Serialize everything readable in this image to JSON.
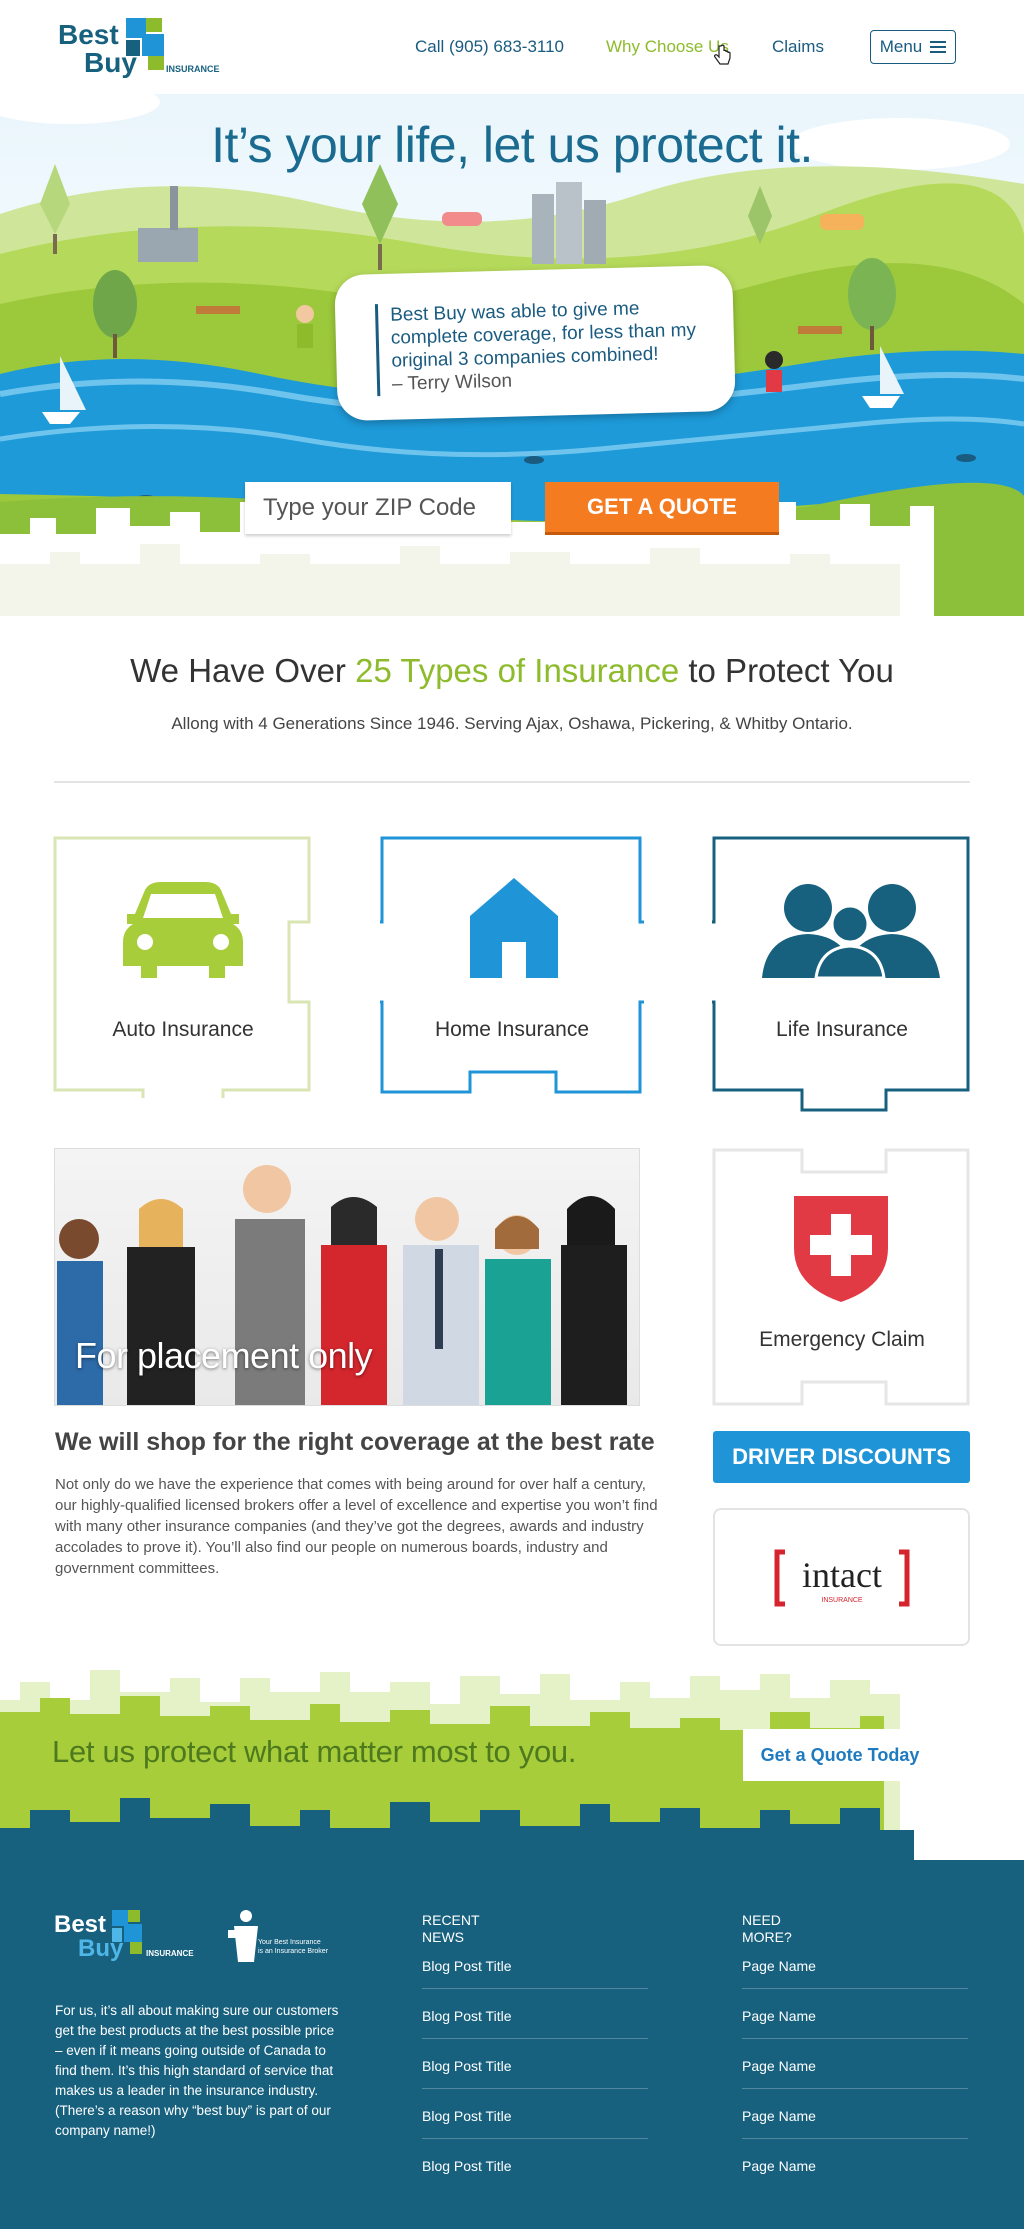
{
  "header": {
    "logo_top": "Best",
    "logo_bottom": "Buy",
    "logo_tag": "INSURANCE",
    "nav": [
      {
        "label": "Call (905) 683-3110"
      },
      {
        "label": "Why Choose Us"
      },
      {
        "label": "Claims"
      }
    ],
    "menu_label": "Menu"
  },
  "hero": {
    "title": "It’s your life, let us protect it.",
    "testimonial": "Best Buy was able to give me complete coverage, for less than my original 3 companies combined!",
    "testimonial_author": "– Terry Wilson",
    "zip_placeholder": "Type your ZIP Code",
    "quote_button": "GET A QUOTE"
  },
  "types": {
    "title_pre": "We Have Over ",
    "title_highlight": "25 Types of Insurance",
    "title_post": " to Protect You",
    "subtitle": "Allong with 4 Generations Since 1946. Serving Ajax, Oshawa, Pickering, & Whitby Ontario.",
    "tiles": [
      {
        "label": "Auto Insurance",
        "icon": "car-icon",
        "color": "#a8cd3a"
      },
      {
        "label": "Home Insurance",
        "icon": "house-icon",
        "color": "#1f95d8"
      },
      {
        "label": "Life Insurance",
        "icon": "family-icon",
        "color": "#17617f"
      },
      {
        "label": "Emergency Claim",
        "icon": "swiss-cross-shield-icon",
        "color": "#e23a45"
      }
    ]
  },
  "team": {
    "placement_text": "For placement only"
  },
  "shop": {
    "title": "We will shop for the right coverage at the best rate",
    "body": "Not only do we have the experience that comes with being around for over half a century, our highly-qualified licensed brokers offer a level of excellence and expertise you won’t find with many other insurance companies (and they’ve got the degrees, awards and industry accolades to prove it). You’ll also find our people on numerous boards, industry and government committees."
  },
  "sidebar": {
    "driver_discounts": "DRIVER DISCOUNTS",
    "partner_logo": "intact",
    "partner_logo_sub": "INSURANCE"
  },
  "cta": {
    "text": "Let us protect what matter most to you.",
    "button": "Get a Quote Today"
  },
  "footer": {
    "logo_top": "Best",
    "logo_bottom": "Buy",
    "logo_tag": "INSURANCE",
    "broker_line1": "Your Best Insurance",
    "broker_line2": "is an Insurance Broker",
    "about": "For us, it’s all about making sure our customers get the best products at the best possible price – even if it means going outside of Canada to find them. It’s this high standard of service that makes us a leader in the insurance industry. (There’s a reason why “best buy” is part of our company name!)",
    "news_title_1": "RECENT",
    "news_title_2": "NEWS",
    "news": [
      "Blog Post Title",
      "Blog Post Title",
      "Blog Post Title",
      "Blog Post Title",
      "Blog Post Title"
    ],
    "more_title_1": "NEED",
    "more_title_2": "MORE?",
    "more": [
      "Page Name",
      "Page Name",
      "Page Name",
      "Page Name",
      "Page Name"
    ]
  },
  "colors": {
    "brand_blue": "#17617f",
    "accent_green": "#8dbb2c",
    "accent_orange": "#f47b20",
    "sky_blue": "#1f95d8"
  }
}
